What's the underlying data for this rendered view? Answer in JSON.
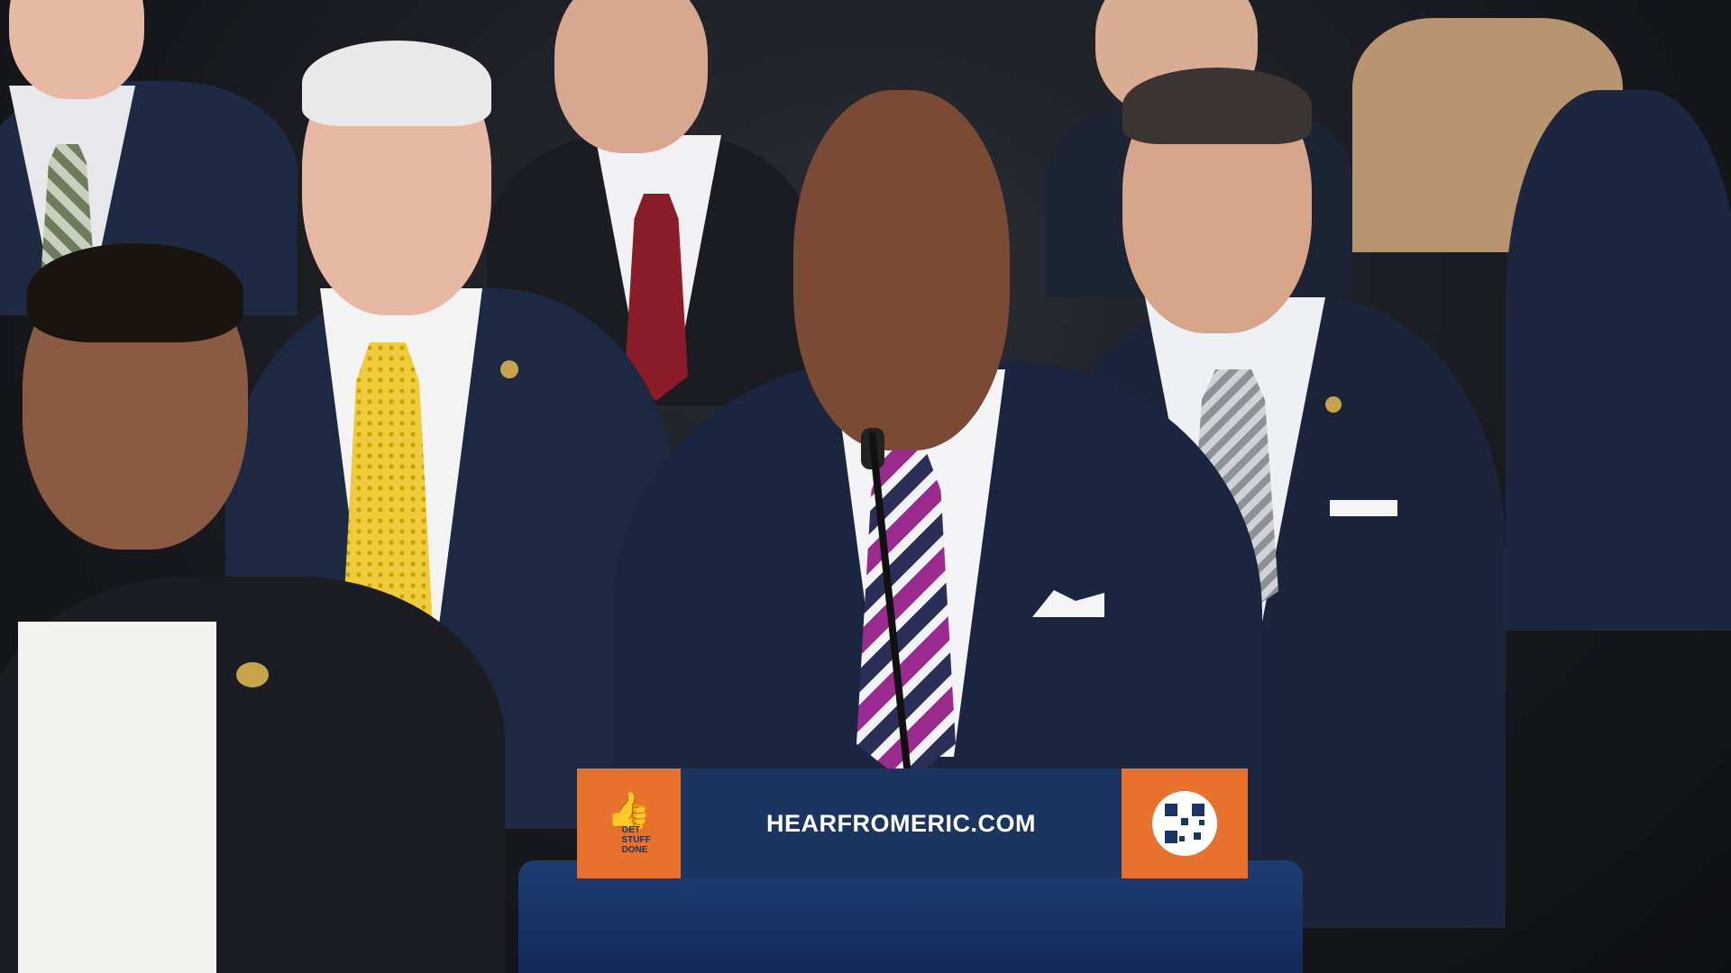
{
  "scene": {
    "podium_url": "HEARFROMERIC.COM",
    "logo_text": "GET STUFF DONE",
    "colors": {
      "podium_navy": "#1a3562",
      "podium_orange": "#e8712e",
      "suit_navy": "#1b2438",
      "background": "#17191e"
    },
    "icons": [
      "thumbs-up-icon",
      "qr-code-icon"
    ]
  }
}
